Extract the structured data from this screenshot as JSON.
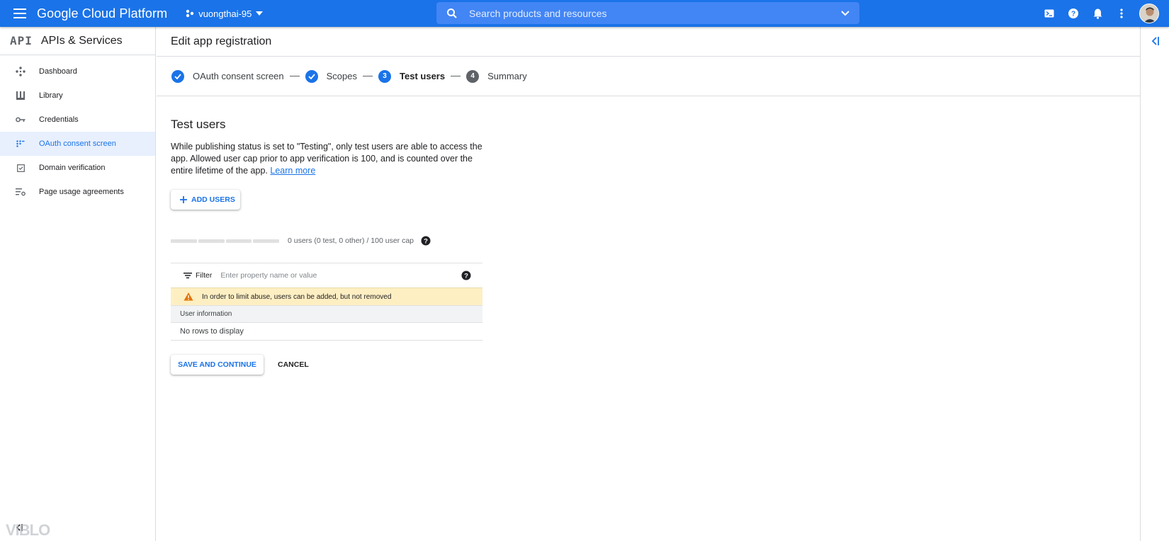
{
  "topbar": {
    "brand": "Google Cloud Platform",
    "project": "vuongthai-95",
    "search_placeholder": "Search products and resources",
    "colors": {
      "bar": "#1a73e8",
      "search": "#4285f4"
    }
  },
  "sidebar": {
    "logo": "API",
    "title": "APIs & Services",
    "items": [
      {
        "label": "Dashboard",
        "icon": "dashboard-icon"
      },
      {
        "label": "Library",
        "icon": "library-icon"
      },
      {
        "label": "Credentials",
        "icon": "key-icon"
      },
      {
        "label": "OAuth consent screen",
        "icon": "consent-icon",
        "active": true
      },
      {
        "label": "Domain verification",
        "icon": "checkbox-icon"
      },
      {
        "label": "Page usage agreements",
        "icon": "settings-list-icon"
      }
    ]
  },
  "page": {
    "title": "Edit app registration",
    "steps": [
      {
        "label": "OAuth consent screen",
        "state": "done"
      },
      {
        "label": "Scopes",
        "state": "done"
      },
      {
        "label": "Test users",
        "number": "3",
        "state": "current"
      },
      {
        "label": "Summary",
        "number": "4",
        "state": "todo"
      }
    ]
  },
  "test_users": {
    "title": "Test users",
    "description": "While publishing status is set to \"Testing\", only test users are able to access the app. Allowed user cap prior to app verification is 100, and is counted over the entire lifetime of the app.",
    "learn_more": "Learn more",
    "add_users": "ADD USERS",
    "cap_text": "0 users (0 test, 0 other) / 100 user cap",
    "filter_label": "Filter",
    "filter_placeholder": "Enter property name or value",
    "warning": "In order to limit abuse, users can be added, but not removed",
    "column_header": "User information",
    "empty_text": "No rows to display"
  },
  "actions": {
    "save": "SAVE AND CONTINUE",
    "cancel": "CANCEL"
  },
  "watermark": "VIBLO"
}
